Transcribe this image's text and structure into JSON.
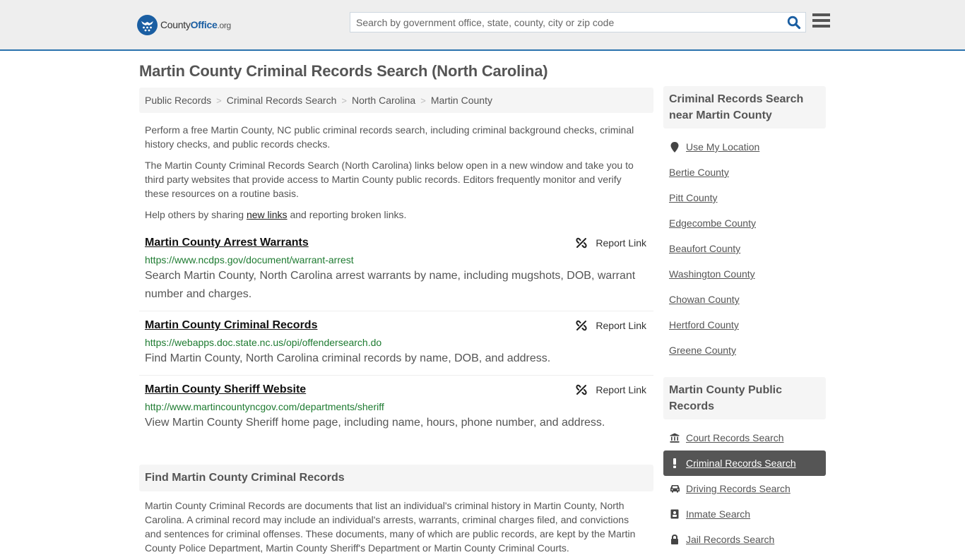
{
  "header": {
    "logo": {
      "brand_prefix": "County",
      "brand_main": "Office",
      "brand_suffix": ".org"
    },
    "search": {
      "placeholder": "Search by government office, state, county, city or zip code",
      "value": ""
    },
    "colors": {
      "brand_blue": "#1a5ea2",
      "header_bg": "#eeeeee",
      "header_border": "#2a72ad"
    }
  },
  "page": {
    "title": "Martin County Criminal Records Search (North Carolina)"
  },
  "breadcrumb": [
    {
      "label": "Public Records"
    },
    {
      "label": "Criminal Records Search"
    },
    {
      "label": "North Carolina"
    },
    {
      "label": "Martin County"
    }
  ],
  "intro": {
    "p1": "Perform a free Martin County, NC public criminal records search, including criminal background checks, criminal history checks, and public records checks.",
    "p2": "The Martin County Criminal Records Search (North Carolina) links below open in a new window and take you to third party websites that provide access to Martin County public records. Editors frequently monitor and verify these resources on a routine basis.",
    "p3_before": "Help others by sharing ",
    "p3_link": "new links",
    "p3_after": " and reporting broken links."
  },
  "links": [
    {
      "title": "Martin County Arrest Warrants",
      "url": "https://www.ncdps.gov/document/warrant-arrest",
      "description": "Search Martin County, North Carolina arrest warrants by name, including mugshots, DOB, warrant number and charges.",
      "report_label": "Report Link"
    },
    {
      "title": "Martin County Criminal Records",
      "url": "https://webapps.doc.state.nc.us/opi/offendersearch.do",
      "description": "Find Martin County, North Carolina criminal records by name, DOB, and address.",
      "report_label": "Report Link"
    },
    {
      "title": "Martin County Sheriff Website",
      "url": "http://www.martincountyncgov.com/departments/sheriff",
      "description": "View Martin County Sheriff home page, including name, hours, phone number, and address.",
      "report_label": "Report Link"
    }
  ],
  "find_section": {
    "heading": "Find Martin County Criminal Records",
    "body": "Martin County Criminal Records are documents that list an individual's criminal history in Martin County, North Carolina. A criminal record may include an individual's arrests, warrants, criminal charges filed, and convictions and sentences for criminal offenses. These documents, many of which are public records, are kept by the Martin County Police Department, Martin County Sheriff's Department or Martin County Criminal Courts."
  },
  "sidebar": {
    "nearby": {
      "heading": "Criminal Records Search near Martin County",
      "use_location": {
        "label": "Use My Location",
        "icon": "map-marker-icon"
      },
      "items": [
        {
          "label": "Bertie County"
        },
        {
          "label": "Pitt County"
        },
        {
          "label": "Edgecombe County"
        },
        {
          "label": "Beaufort County"
        },
        {
          "label": "Washington County"
        },
        {
          "label": "Chowan County"
        },
        {
          "label": "Hertford County"
        },
        {
          "label": "Greene County"
        }
      ]
    },
    "public_records": {
      "heading": "Martin County Public Records",
      "items": [
        {
          "label": "Court Records Search",
          "icon": "courthouse-icon",
          "active": false
        },
        {
          "label": "Criminal Records Search",
          "icon": "exclamation-icon",
          "active": true
        },
        {
          "label": "Driving Records Search",
          "icon": "car-icon",
          "active": false
        },
        {
          "label": "Inmate Search",
          "icon": "id-badge-icon",
          "active": false
        },
        {
          "label": "Jail Records Search",
          "icon": "lock-icon",
          "active": false
        }
      ]
    }
  }
}
